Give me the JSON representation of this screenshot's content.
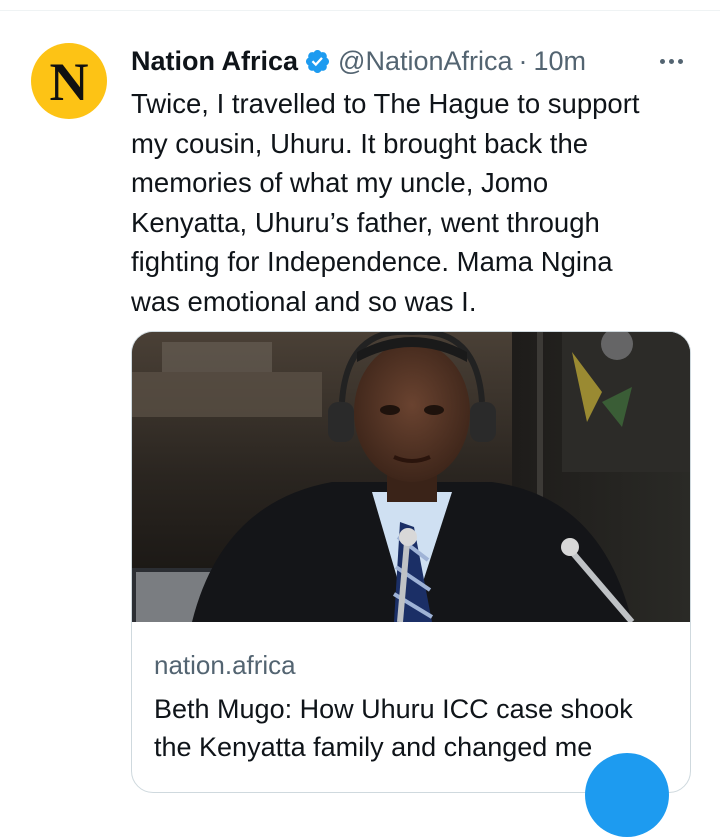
{
  "tweet": {
    "avatar_letter": "N",
    "display_name": "Nation Africa",
    "verified_icon": "verified-badge-icon",
    "handle": "@NationAfrica",
    "separator": "·",
    "time": "10m",
    "more_icon": "more-options-icon",
    "text": "Twice, I travelled to The Hague to support\nmy cousin, Uhuru. It brought back the\nmemories of what my uncle, Jomo\nKenyatta, Uhuru’s father, went through\nfighting for Independence. Mama Ngina\nwas emotional and so was I.",
    "card": {
      "domain": "nation.africa",
      "title": "Beth Mugo: How Uhuru ICC case shook\nthe Kenyatta family and changed me"
    }
  },
  "colors": {
    "avatar_bg": "#fdc315",
    "verified": "#1d9bf0",
    "secondary_text": "#536471",
    "fab": "#1d9bf0"
  },
  "fab_icon": "compose-tweet-icon"
}
